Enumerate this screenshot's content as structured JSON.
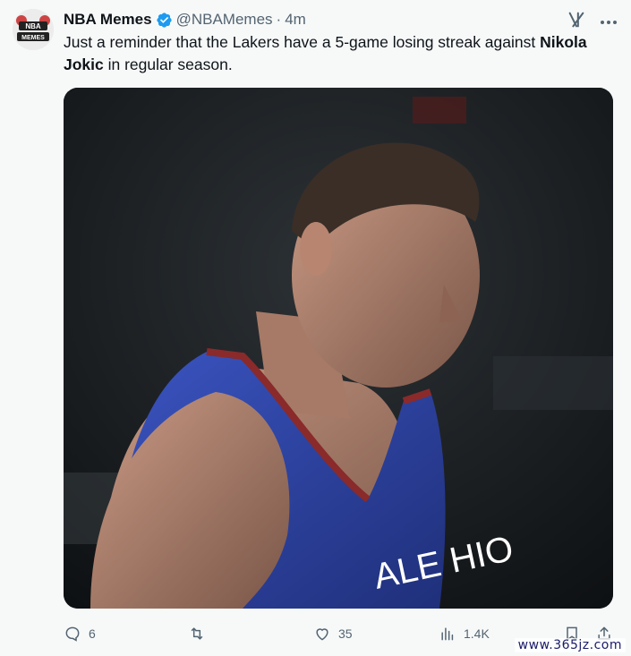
{
  "author": {
    "name": "NBA Memes",
    "handle": "@NBAMemes",
    "separator": "·",
    "time": "4m",
    "avatar_text_top": "NBA",
    "avatar_text_bottom": "MEMES"
  },
  "tweet": {
    "text_part1": "Just a reminder that the Lakers have a 5-game losing streak against ",
    "text_bold": "Nikola Jokic",
    "text_part2": " in regular season.",
    "media_icon": "player-photo",
    "jersey_text": "ALE HIO"
  },
  "actions": {
    "replies": "6",
    "reposts": "",
    "likes": "35",
    "views": "1.4K"
  },
  "icons": {
    "reply": "reply-icon",
    "repost": "repost-icon",
    "like": "like-icon",
    "views": "views-icon",
    "bookmark": "bookmark-icon",
    "share": "share-icon",
    "grok": "grok-icon",
    "more": "more-icon",
    "verified": "verified-badge-icon"
  },
  "colors": {
    "verified": "#1d9bf0",
    "secondary_text": "#536471",
    "jersey": "#2b44a8",
    "jersey_trim": "#8a2a2a"
  },
  "watermark": "www.365jz.com"
}
